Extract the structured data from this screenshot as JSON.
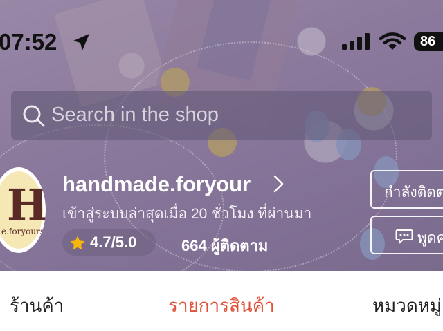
{
  "status_bar": {
    "time": "07:52",
    "battery": "86"
  },
  "search": {
    "placeholder": "Search in the shop"
  },
  "shop": {
    "name": "handmade.foryour",
    "last_login": "เข้าสู่ระบบล่าสุดเมื่อ 20 ชั่วโมง ที่ผ่านมา",
    "rating": "4.7/5.0",
    "followers": "664 ผู้ติดตาม",
    "avatar_letter": "H",
    "avatar_text": "e.foryours"
  },
  "buttons": {
    "follow": "กำลังติดต",
    "chat": "พูดค"
  },
  "tabs": [
    "ร้านค้า",
    "รายการสินค้า",
    "หมวดหมู่"
  ],
  "colors": {
    "active_tab": "#e0533a",
    "star": "#f5b50a"
  }
}
